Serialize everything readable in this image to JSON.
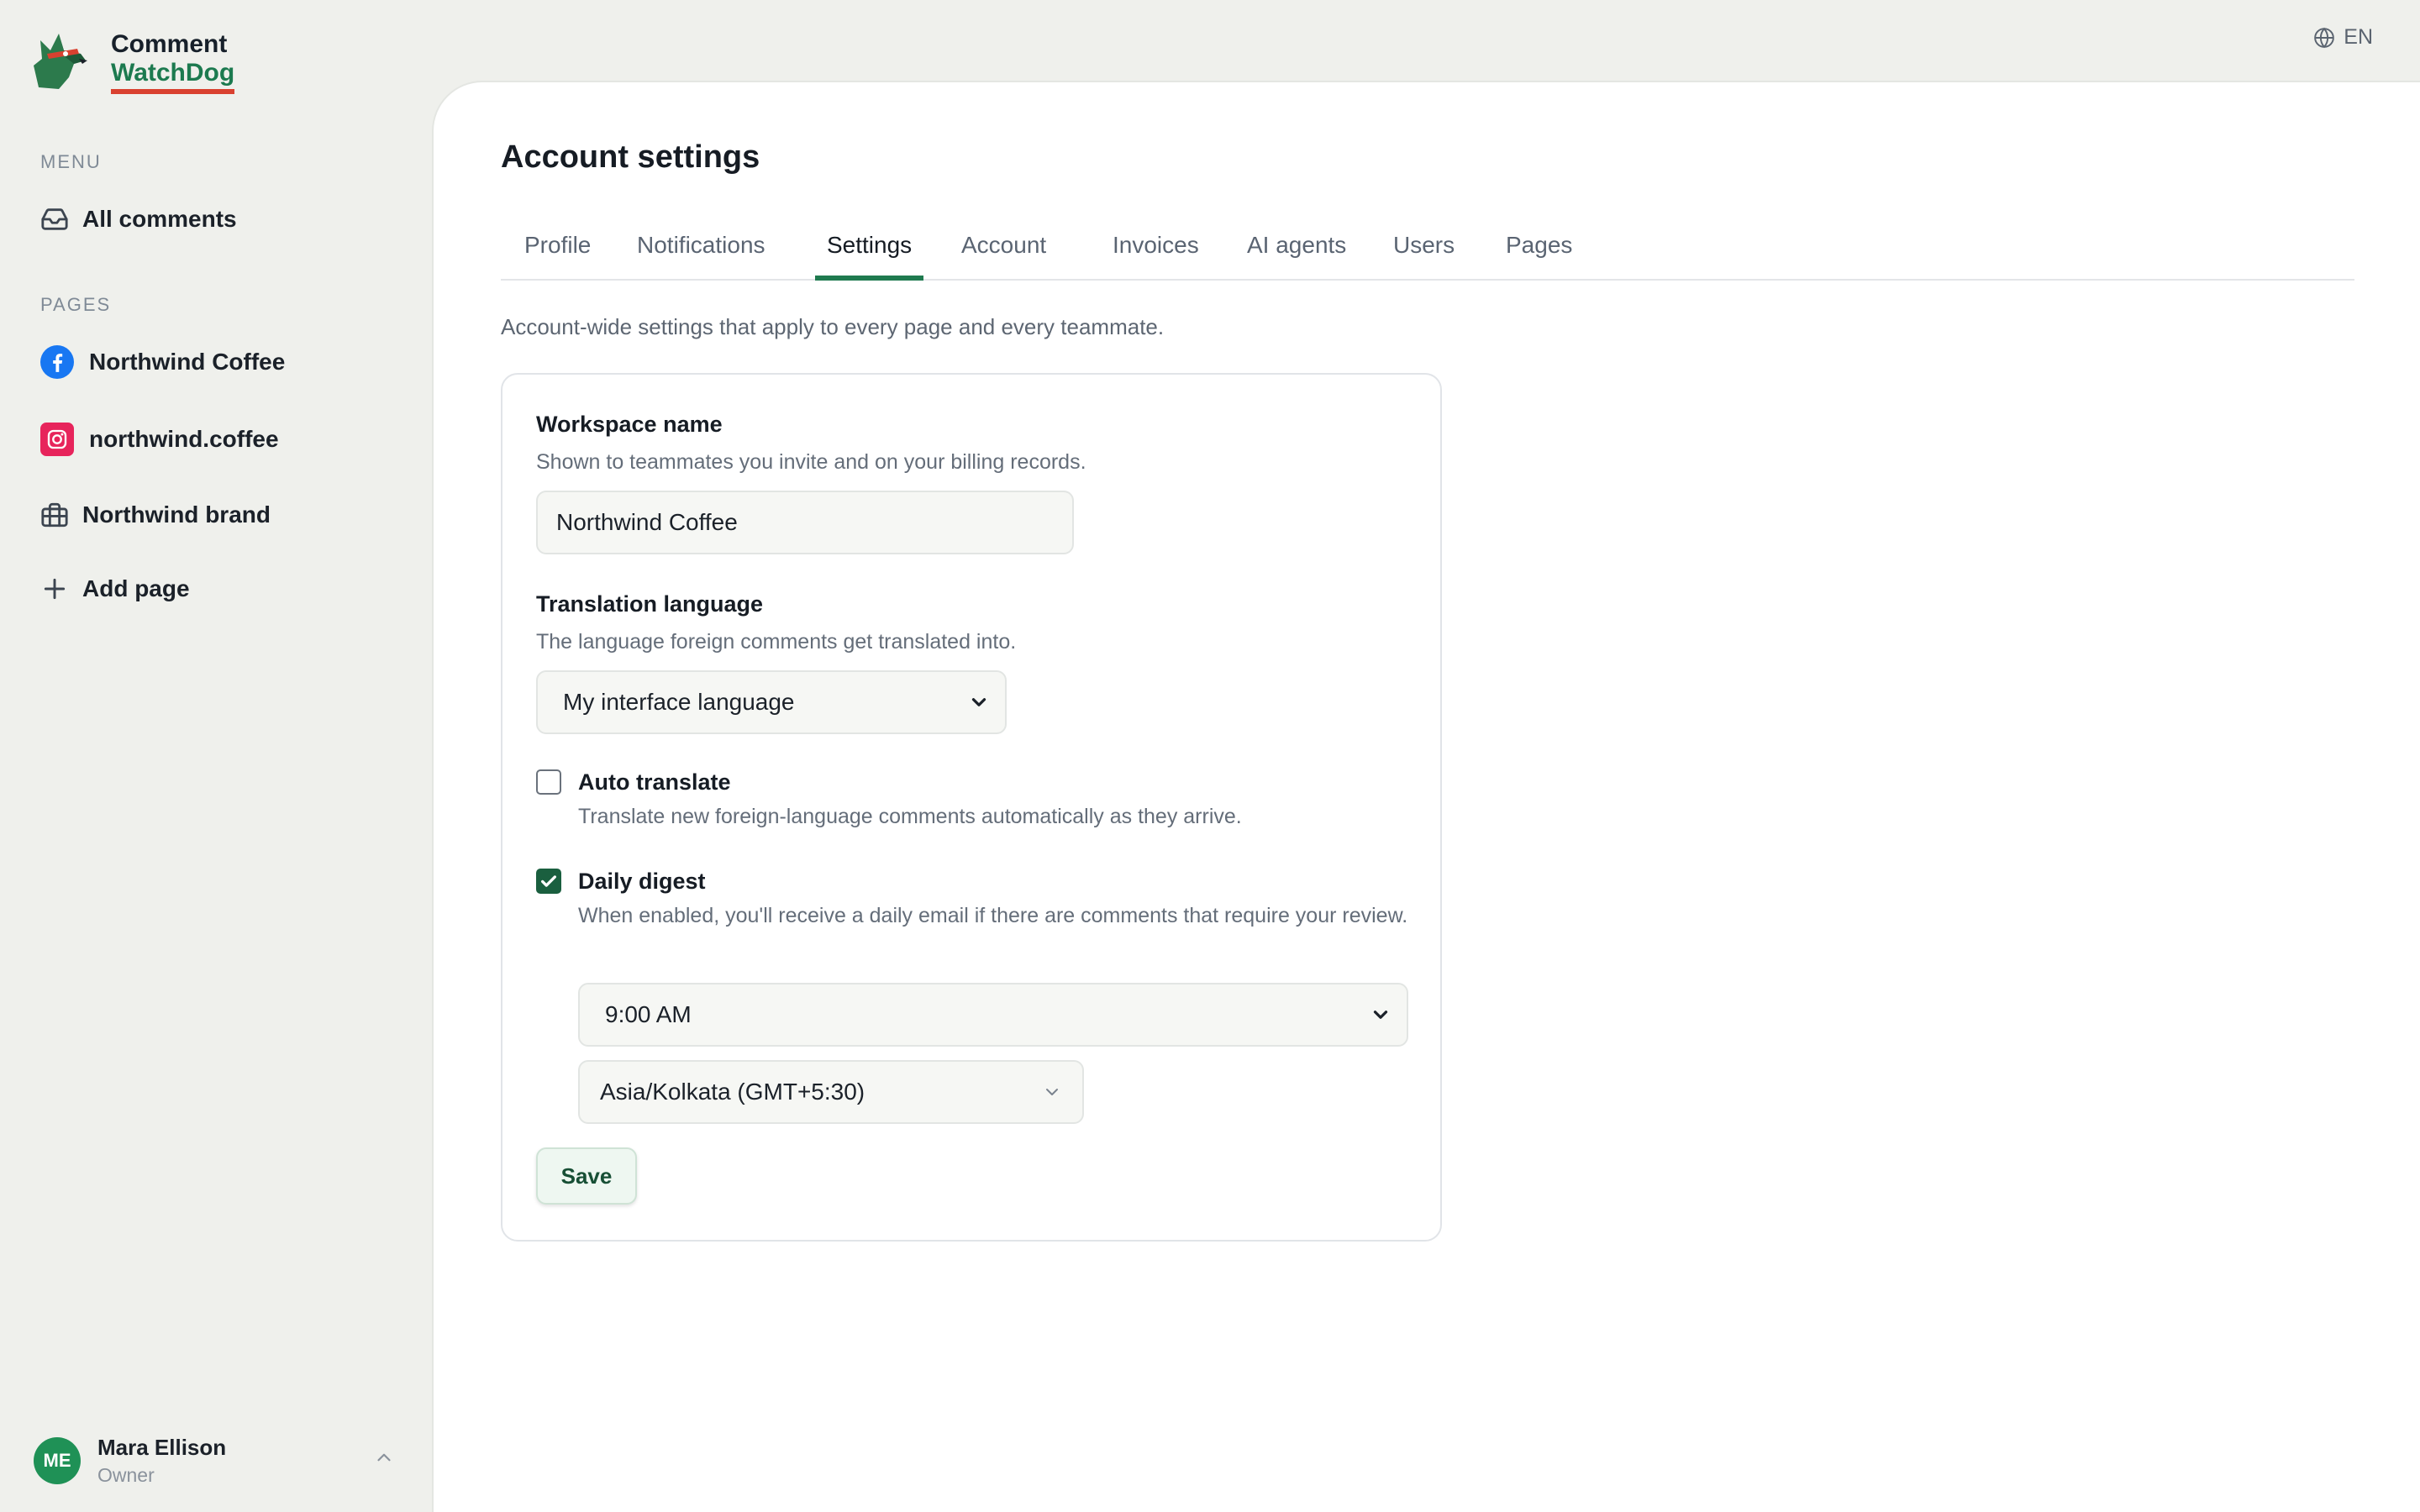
{
  "brand": {
    "line1": "Comment",
    "line2": "WatchDog"
  },
  "language_switch": {
    "label": "EN"
  },
  "sidebar": {
    "menu_label": "MENU",
    "menu_items": [
      {
        "label": "All comments",
        "icon": "inbox-icon"
      }
    ],
    "pages_label": "PAGES",
    "pages": [
      {
        "label": "Northwind Coffee",
        "icon": "facebook-icon"
      },
      {
        "label": "northwind.coffee",
        "icon": "instagram-icon"
      },
      {
        "label": "Northwind brand",
        "icon": "briefcase-icon"
      }
    ],
    "add_page": {
      "label": "Add page",
      "icon": "plus-icon"
    }
  },
  "user": {
    "initials": "ME",
    "name": "Mara Ellison",
    "role": "Owner"
  },
  "main": {
    "title": "Account settings",
    "tabs": [
      {
        "label": "Profile",
        "active": false
      },
      {
        "label": "Notifications",
        "active": false
      },
      {
        "label": "Settings",
        "active": true
      },
      {
        "label": "Account",
        "active": false
      },
      {
        "label": "Invoices",
        "active": false
      },
      {
        "label": "AI agents",
        "active": false
      },
      {
        "label": "Users",
        "active": false
      },
      {
        "label": "Pages",
        "active": false
      }
    ],
    "intro": "Account-wide settings that apply to every page and every teammate."
  },
  "form": {
    "workspace": {
      "label": "Workspace name",
      "help": "Shown to teammates you invite and on your billing records.",
      "value": "Northwind Coffee"
    },
    "translation": {
      "label": "Translation language",
      "help": "The language foreign comments get translated into.",
      "selected": "My interface language"
    },
    "auto_translate": {
      "label": "Auto translate",
      "help": "Translate new foreign-language comments automatically as they arrive.",
      "checked": false
    },
    "daily_digest": {
      "label": "Daily digest",
      "help": "When enabled, you'll receive a daily email if there are comments that require your review.",
      "checked": true,
      "time": "9:00 AM",
      "timezone": "Asia/Kolkata (GMT+5:30)"
    },
    "save_label": "Save"
  },
  "colors": {
    "accent": "#1f7a4f",
    "brand_underline": "#d94130",
    "avatar": "#1f9156",
    "background": "#eff0ec"
  }
}
